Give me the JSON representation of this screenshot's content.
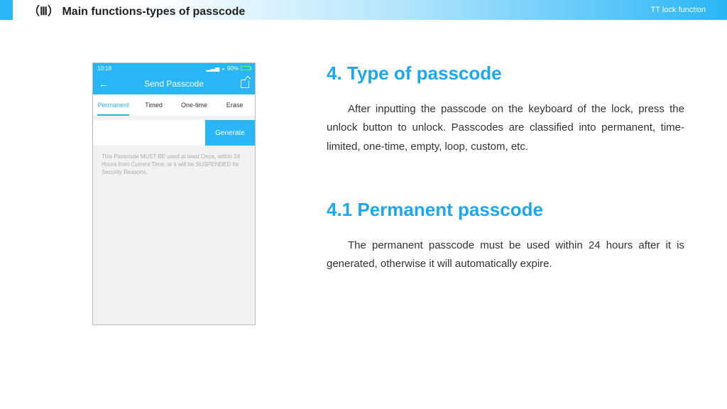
{
  "topbar": {
    "title": "（Ⅲ） Main functions-types of passcode",
    "right": "TT lock function"
  },
  "phone": {
    "status_time": "10:18",
    "status_battery": "90%",
    "header_title": "Send Passcode",
    "tabs": [
      "Permanent",
      "Timed",
      "One-time",
      "Erase"
    ],
    "generate": "Generate",
    "note": "This Passcode MUST BE used at least Once, within 24 Hours from Current Time, or it will be SUSPENDED for Security Reasons."
  },
  "section1": {
    "heading": "4. Type of passcode",
    "body": "After inputting the passcode on the keyboard of the lock, press the unlock button to unlock. Passcodes are classified into permanent, time-limited, one-time, empty, loop, custom, etc."
  },
  "section2": {
    "heading": "4.1 Permanent passcode",
    "body": "The permanent passcode must be used within 24 hours after it is generated, otherwise it will automatically expire."
  }
}
